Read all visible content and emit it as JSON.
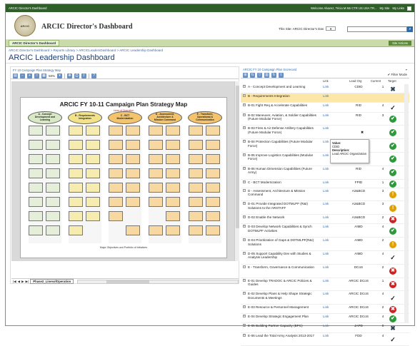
{
  "topbar": {
    "site_title": "ARCIC Director's Dashboard",
    "welcome": "Welcome Alvarez, Tricia M Ms CTR US USA TR...",
    "my_site": "My Site",
    "my_links": "My Links"
  },
  "header": {
    "logo_text": "ARCIC",
    "site_title": "ARCIC Director's Dashboard",
    "this_site_label": "This Site: ARCIC Director's Das",
    "search_placeholder": ""
  },
  "nav": {
    "tab": "ARCIC Director's Dashboard",
    "site_actions": "Site Actions"
  },
  "breadcrumb": "ARCIC Director's Dashboard > Reports Library > ARCICLeadersDashboard > ARCIC Leadership Dashboard",
  "page_title": "ARCIC Leadership Dashboard",
  "left_panel": {
    "title": "FY 10 Campaign Plan Strategy Map",
    "zoom": "58%",
    "sheet_tab": "Phase2_LinesofOperation",
    "slide": {
      "title": "ARCIC FY 10-11 Campaign Plan Strategy Map",
      "subtitle": "Lines of Operation",
      "bottom_caption": "Major Objectives and Portfolio of Initiatives",
      "lines": [
        {
          "label": "A - Concept Development and Learning",
          "color": "#d9e8c5"
        },
        {
          "label": "B - Requirements Integration",
          "color": "#f2e38a"
        },
        {
          "label": "C - BCT Modernization",
          "color": "#f3c46b"
        },
        {
          "label": "D - Assessment, Architecture & Mission Command",
          "color": "#f3c46b"
        },
        {
          "label": "E - Transform, Operational & Communication",
          "color": "#f3c46b"
        }
      ]
    }
  },
  "right_panel": {
    "title": "ARCIC FY 10 Campaign Plan Scorecard",
    "filter_mode": "Filter Mode",
    "columns": {
      "link": "Link",
      "lead": "Lead Org",
      "current": "Current",
      "target": "Target"
    },
    "rows": [
      {
        "name": "A - Concept Development and Learning",
        "link": "Link",
        "lead": "CDID",
        "current": "1",
        "target": "x",
        "exp": "+",
        "highlight": false
      },
      {
        "name": "B - Requirements Integration",
        "link": "Link",
        "lead": "",
        "current": "",
        "target": "",
        "exp": "−",
        "highlight": true
      },
      {
        "name": "B-01 Fight Req & Accelerate Capabilities",
        "link": "Link",
        "lead": "RID",
        "current": "4",
        "target": "c",
        "exp": "+",
        "highlight": false
      },
      {
        "name": "B-02 Maneuver, Aviation, & Soldier Capabilities (Future Modular Force)",
        "link": "Link",
        "lead": "RID",
        "current": "3",
        "target": "g",
        "exp": "+",
        "highlight": false
      },
      {
        "name": "B-03 Fires & Air Defense Artillery Capabilities (Future Modular Force)",
        "link": "Link",
        "lead": "",
        "current": "",
        "target": "g",
        "exp": "+",
        "highlight": false
      },
      {
        "name": "B-04 Protection Capabilities (Future Modular Force)",
        "link": "Link",
        "lead": "",
        "current": "",
        "target": "g",
        "exp": "+",
        "highlight": false
      },
      {
        "name": "B-05 Improve Logistics Capabilities (Modular Force)",
        "link": "Link",
        "lead": "",
        "current": "",
        "target": "g",
        "exp": "+",
        "highlight": false
      },
      {
        "name": "B-06 Human Dimension Capabilities (Future Army)",
        "link": "Link",
        "lead": "RID",
        "current": "4",
        "target": "g",
        "exp": "+",
        "highlight": false
      },
      {
        "name": "C - BCT Modernization",
        "link": "Link",
        "lead": "FPID",
        "current": "1",
        "target": "g",
        "exp": "+",
        "highlight": false
      },
      {
        "name": "D - Assessment, Architecture & Mission Command",
        "link": "Link",
        "lead": "A2&BCD",
        "current": "3",
        "target": "y",
        "exp": "−",
        "highlight": false
      },
      {
        "name": "D-01 Provide Integrated DOTMLPF (R&I) Solutions to the ARSTAFF",
        "link": "Link",
        "lead": "A2&BCD",
        "current": "3",
        "target": "y",
        "exp": "+",
        "highlight": false
      },
      {
        "name": "D-02 Enable the Network",
        "link": "Link",
        "lead": "A2&BCD",
        "current": "2",
        "target": "r",
        "exp": "+",
        "highlight": false
      },
      {
        "name": "D-03 Develop Network Capabilities & Synch DOTMLPF Activities",
        "link": "Link",
        "lead": "AIMD",
        "current": "4",
        "target": "g",
        "exp": "+",
        "highlight": false
      },
      {
        "name": "D-04 Prioritization of Gaps & DOTMLPF(R&I) Solutions",
        "link": "Link",
        "lead": "AIMD",
        "current": "2",
        "target": "y",
        "exp": "+",
        "highlight": false
      },
      {
        "name": "D-05 Support Capability Dev with Studies & Analysis Leadership",
        "link": "Link",
        "lead": "AIMD",
        "current": "4",
        "target": "c",
        "exp": "+",
        "highlight": false
      },
      {
        "name": "E - Transform, Governance & Communication",
        "link": "Link",
        "lead": "DCoS",
        "current": "2",
        "target": "r",
        "exp": "−",
        "highlight": false
      },
      {
        "name": "E-01 Develop TRADOC & ARCIC Policies & Guides",
        "link": "Link",
        "lead": "ARCIC DCoS",
        "current": "1",
        "target": "r",
        "exp": "+",
        "highlight": false
      },
      {
        "name": "E-02 Develop Plans & Help Shape Strategic Documents & Meetings",
        "link": "Link",
        "lead": "ARCIC DCoS",
        "current": "4",
        "target": "c",
        "exp": "+",
        "highlight": false
      },
      {
        "name": "E-03 Resource & Personnel Management",
        "link": "Link",
        "lead": "ARCIC DCoS",
        "current": "2",
        "target": "r",
        "exp": "+",
        "highlight": false
      },
      {
        "name": "E-04 Develop Strategic Engagement Plan",
        "link": "Link",
        "lead": "ARCIC DCoS",
        "current": "4",
        "target": "g",
        "exp": "+",
        "highlight": false
      },
      {
        "name": "E-05 Building Partner Capacity (BPC)",
        "link": "Link",
        "lead": "JAPD",
        "current": "0",
        "target": "x",
        "exp": "+",
        "highlight": false
      },
      {
        "name": "E-06 Lead the Total Army Analysis 2013-2017",
        "link": "Link",
        "lead": "FDD",
        "current": "4",
        "target": "c",
        "exp": "+",
        "highlight": false
      }
    ],
    "tooltip": {
      "value_label": "Value:",
      "value": "CDID",
      "desc_label": "Description:",
      "desc": "Lead ARCIC Organization"
    }
  }
}
